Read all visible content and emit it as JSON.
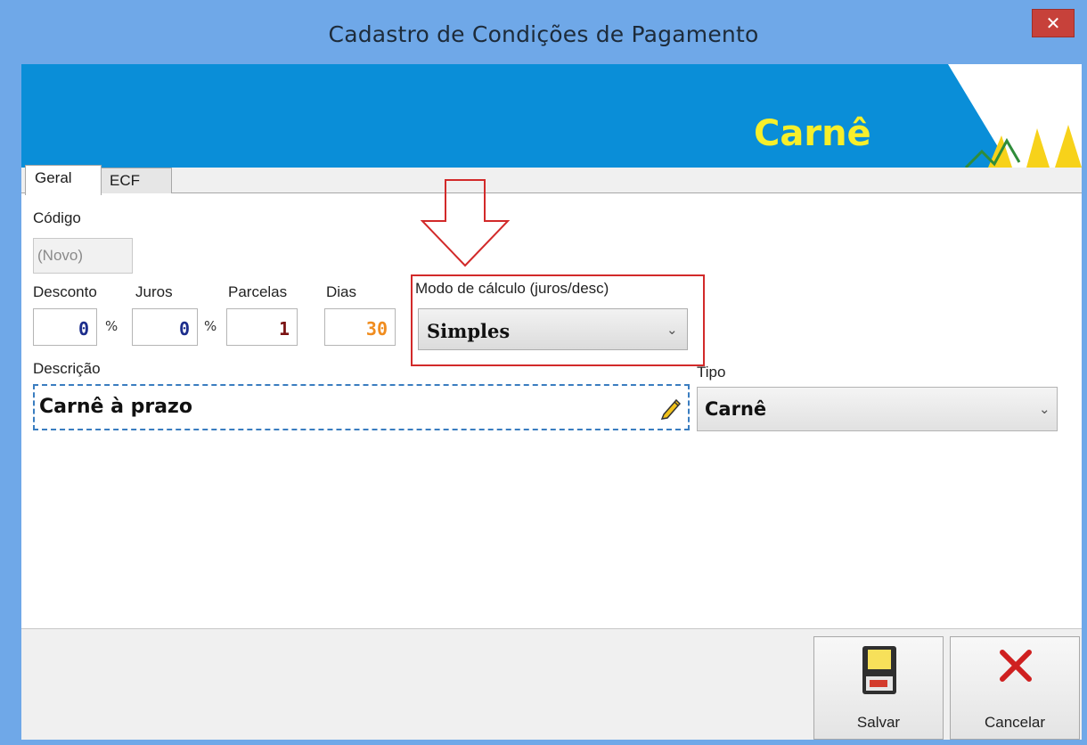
{
  "window": {
    "title": "Cadastro de Condições de Pagamento",
    "close_glyph": "✕"
  },
  "banner": {
    "title": "Carnê",
    "accent_color": "#0a8ed8",
    "title_color": "#f7ef2a"
  },
  "tabs": [
    {
      "label": "Geral",
      "active": true
    },
    {
      "label": "ECF",
      "active": false
    }
  ],
  "form": {
    "codigo_label": "Código",
    "codigo_value": "(Novo)",
    "desconto_label": "Desconto",
    "desconto_value": "0",
    "juros_label": "Juros",
    "juros_value": "0",
    "parcelas_label": "Parcelas",
    "parcelas_value": "1",
    "dias_label": "Dias",
    "dias_value": "30",
    "percent_sign": "%",
    "modo_label": "Modo de cálculo (juros/desc)",
    "modo_value": "Simples",
    "descricao_label": "Descrição",
    "descricao_value": "Carnê à prazo",
    "tipo_label": "Tipo",
    "tipo_value": "Carnê"
  },
  "value_colors": {
    "desconto": "#1c2d8c",
    "juros": "#1c2d8c",
    "parcelas": "#7a1212",
    "dias": "#f08c1e"
  },
  "icons": {
    "close": "close-icon",
    "arrow": "down-arrow-annotation",
    "pencil": "pencil-icon",
    "money": "money-bag-icon",
    "save": "floppy-disk-icon",
    "cancel": "red-x-icon"
  },
  "buttons": {
    "save_label": "Salvar",
    "cancel_label": "Cancelar"
  }
}
